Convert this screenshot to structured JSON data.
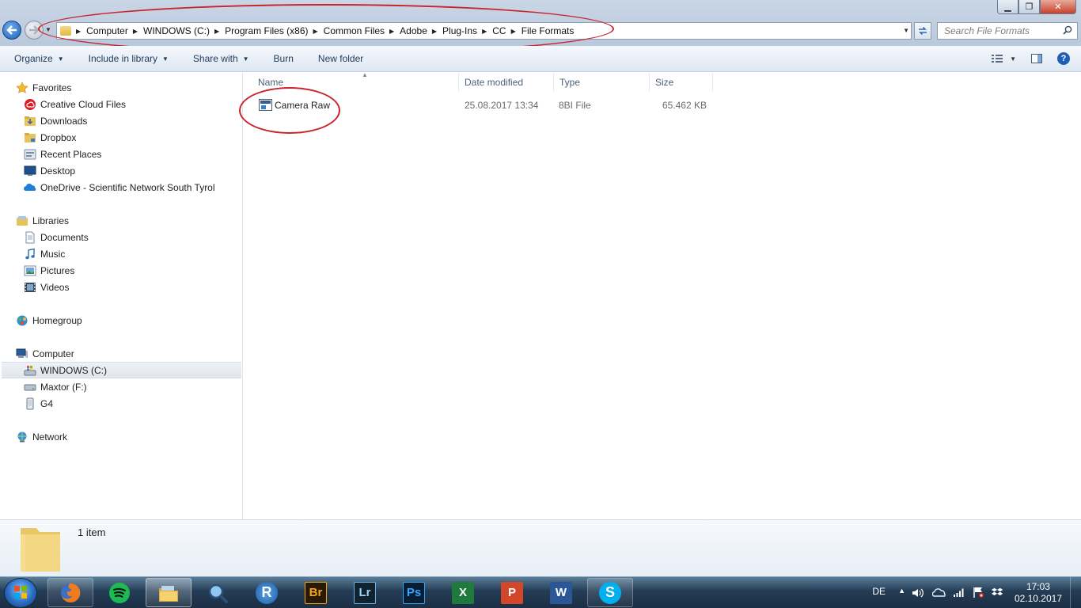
{
  "window": {
    "minimize": "▁",
    "maximize": "❐",
    "close": "✕"
  },
  "address_bar": {
    "crumbs": [
      "Computer",
      "WINDOWS (C:)",
      "Program Files (x86)",
      "Common Files",
      "Adobe",
      "Plug-Ins",
      "CC",
      "File Formats"
    ]
  },
  "search": {
    "placeholder": "Search File Formats"
  },
  "toolbar": {
    "organize": "Organize",
    "include_in_library": "Include in library",
    "share_with": "Share with",
    "burn": "Burn",
    "new_folder": "New folder"
  },
  "nav": {
    "favorites_header": "Favorites",
    "favorites": [
      "Creative Cloud Files",
      "Downloads",
      "Dropbox",
      "Recent Places",
      "Desktop",
      "OneDrive - Scientific Network South Tyrol"
    ],
    "libraries_header": "Libraries",
    "libraries": [
      "Documents",
      "Music",
      "Pictures",
      "Videos"
    ],
    "homegroup": "Homegroup",
    "computer_header": "Computer",
    "computer": [
      "WINDOWS (C:)",
      "Maxtor (F:)",
      "G4"
    ],
    "network": "Network"
  },
  "columns": {
    "name": "Name",
    "date_modified": "Date modified",
    "type": "Type",
    "size": "Size"
  },
  "files": [
    {
      "name": "Camera Raw",
      "date_modified": "25.08.2017 13:34",
      "type": "8BI File",
      "size": "65.462 KB"
    }
  ],
  "details": {
    "item_count": "1 item"
  },
  "taskbar": {
    "apps": [
      "firefox",
      "spotify",
      "file-explorer",
      "magnifier",
      "r",
      "bridge",
      "lightroom",
      "photoshop",
      "excel",
      "powerpoint",
      "word",
      "skype"
    ],
    "bridge_label": "Br",
    "lightroom_label": "Lr",
    "photoshop_label": "Ps",
    "r_label": "R",
    "excel_label": "X",
    "powerpoint_label": "P",
    "word_label": "W",
    "skype_label": "S"
  },
  "tray": {
    "language": "DE",
    "time": "17:03",
    "date": "02.10.2017"
  },
  "colors": {
    "annotation": "#c8242c",
    "link_blue": "#1e395b"
  }
}
